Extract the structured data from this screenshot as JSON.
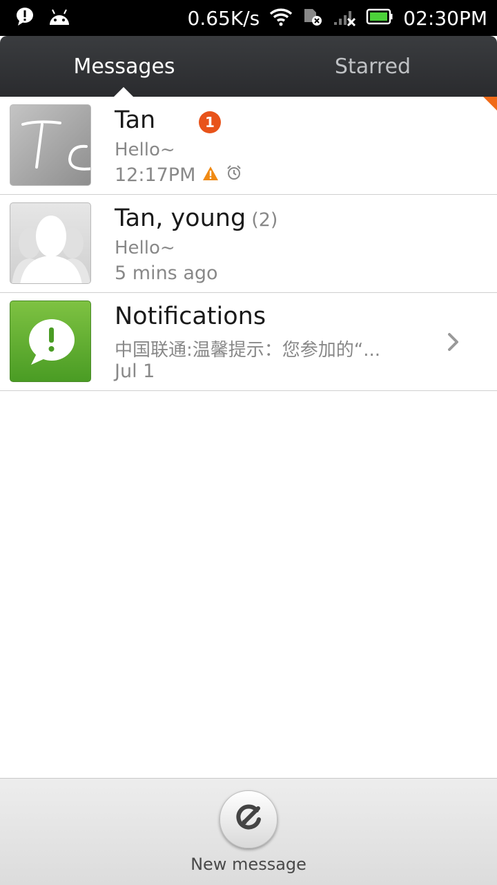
{
  "status_bar": {
    "speed": "0.65K/s",
    "time": "02:30PM",
    "icons": [
      "alert-bubble-icon",
      "android-icon",
      "wifi-icon",
      "sim-disabled-icon",
      "signal-no-service-icon",
      "battery-icon"
    ]
  },
  "tabs": [
    {
      "label": "Messages",
      "selected": true
    },
    {
      "label": "Starred",
      "selected": false
    }
  ],
  "conversations": [
    {
      "name": "Tan",
      "unread_badge": "1",
      "preview": "Hello~",
      "time": "12:17PM",
      "status_icons": [
        "warning-icon",
        "alarm-icon"
      ]
    },
    {
      "name": "Tan, young",
      "count": "(2)",
      "preview": "Hello~",
      "time": "5 mins ago"
    },
    {
      "name": "Notifications",
      "preview": "中国联通:温馨提示：您参加的“...",
      "time": "Jul 1"
    }
  ],
  "bottom": {
    "new_message_label": "New message"
  },
  "colors": {
    "accent_orange": "#e8531a",
    "notification_green": "#5aab2e",
    "tabbar_dark": "#323336"
  }
}
